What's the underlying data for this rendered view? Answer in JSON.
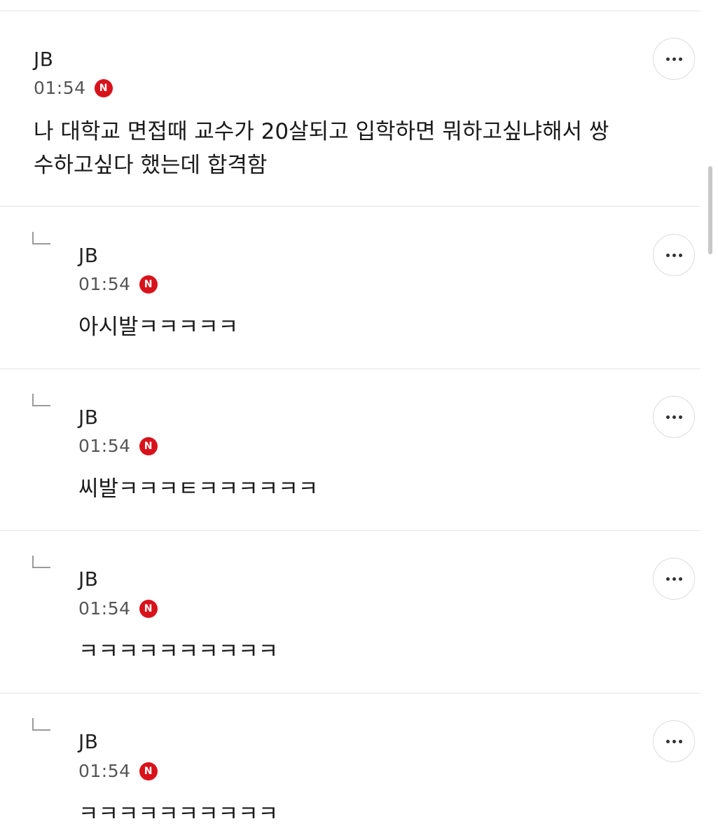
{
  "comments": [
    {
      "author": "JB",
      "time": "01:54",
      "badge": "N",
      "text": "나 대학교 면접때 교수가 20살되고 입학하면 뭐하고싶냐해서 쌍\n수하고싶다 했는데 합격함",
      "more_label": "···"
    }
  ],
  "replies": [
    {
      "author": "JB",
      "time": "01:54",
      "badge": "N",
      "text": "아시발ㅋㅋㅋㅋㅋ"
    },
    {
      "author": "JB",
      "time": "01:54",
      "badge": "N",
      "text": "씨발ㅋㅋㅋㅌㅋㅋㅋㅋㅋㅋ"
    },
    {
      "author": "JB",
      "time": "01:54",
      "badge": "N",
      "text": "ㅋㅋㅋㅋㅋㅋㅋㅋㅋㅋ"
    },
    {
      "author": "JB",
      "time": "01:54",
      "badge": "N",
      "text": "ㅋㅋㅋㅋㅋㅋㅋㅋㅋㅋ"
    }
  ],
  "colors": {
    "new_badge": "#d8121b",
    "divider": "#e4e4e4",
    "text": "#1a1a1a"
  },
  "icons": {
    "more": "more-horizontal-icon",
    "reply": "reply-arrow-icon",
    "new": "new-badge-icon"
  }
}
